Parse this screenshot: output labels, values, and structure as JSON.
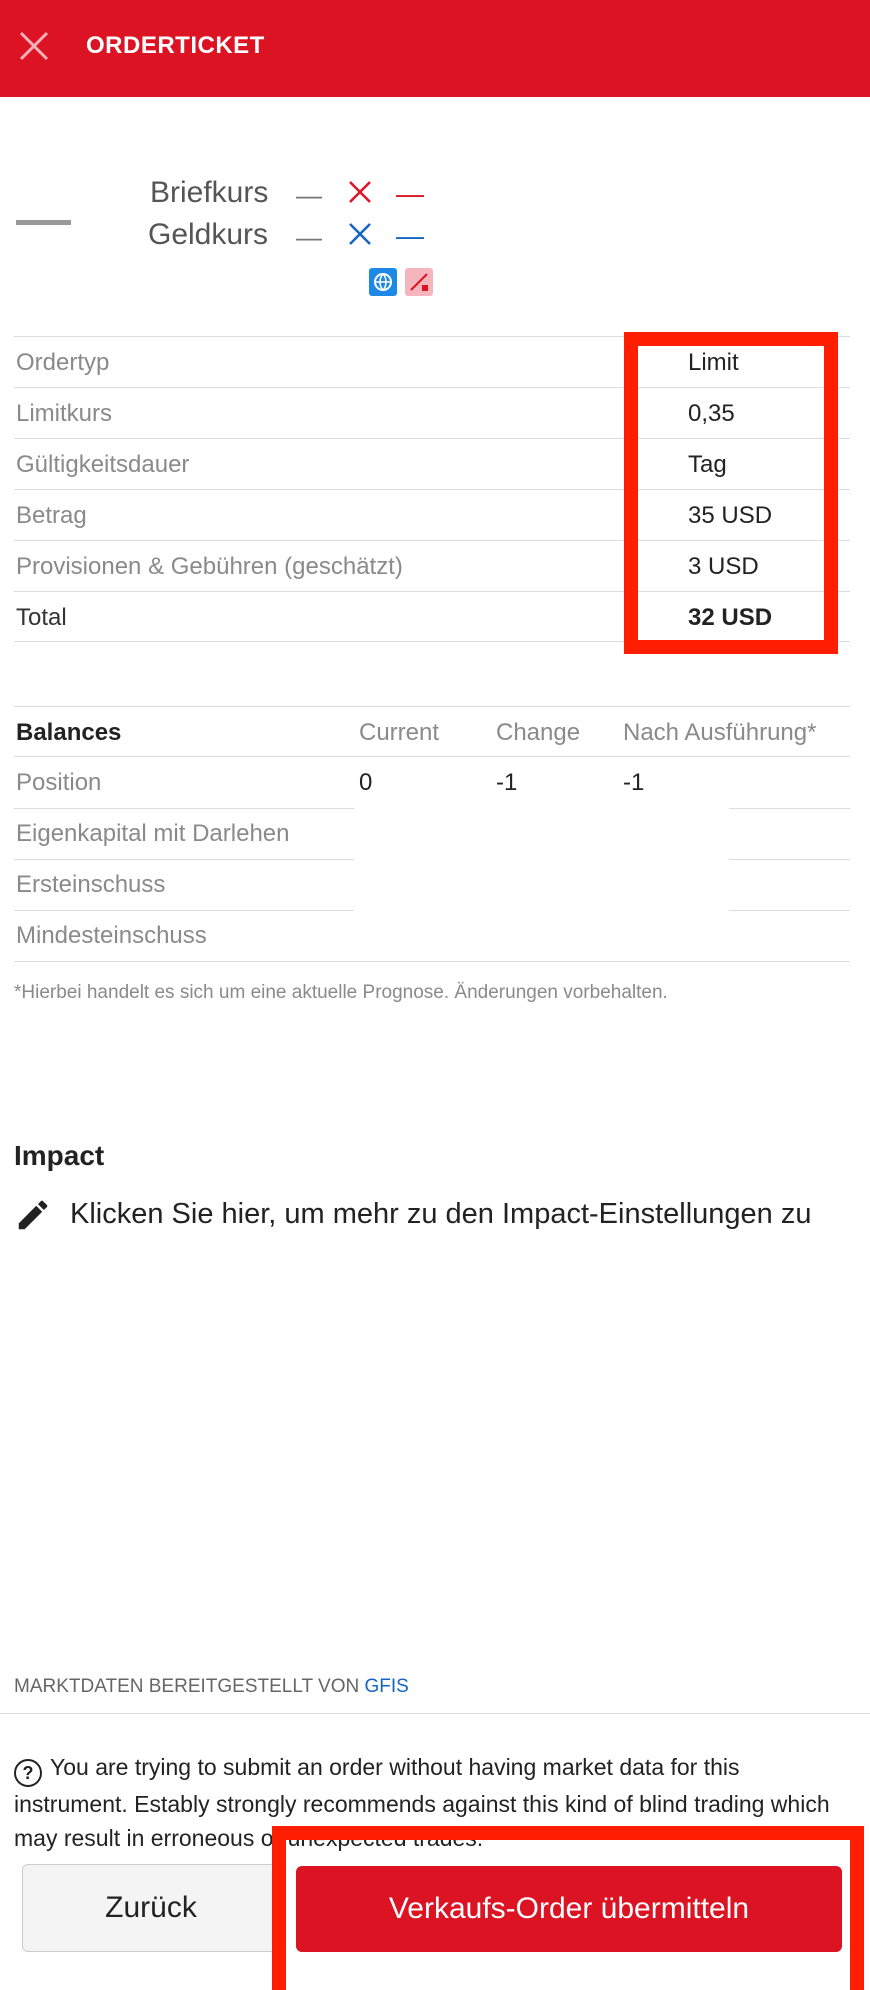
{
  "header": {
    "title": "ORDERTICKET",
    "close_icon": "close-icon"
  },
  "quote": {
    "last_value": "—",
    "ask": {
      "label": "Briefkurs",
      "value": "—",
      "change_icon": "x-icon",
      "change": "—",
      "color": "#dc1323"
    },
    "bid": {
      "label": "Geldkurs",
      "value": "—",
      "change_icon": "x-icon",
      "change": "—",
      "color": "#1565c0"
    },
    "badges": [
      "globe-icon",
      "slash-icon"
    ]
  },
  "order": [
    {
      "label": "Ordertyp",
      "value": "Limit"
    },
    {
      "label": "Limitkurs",
      "value": "0,35"
    },
    {
      "label": "Gültigkeitsdauer",
      "value": "Tag"
    },
    {
      "label": "Betrag",
      "value": "35 USD"
    },
    {
      "label": "Provisionen & Gebühren (geschätzt)",
      "value": "3 USD"
    },
    {
      "label": "Total",
      "value": "32 USD"
    }
  ],
  "balances": {
    "headers": {
      "title": "Balances",
      "current": "Current",
      "change": "Change",
      "after": "Nach Ausführung*"
    },
    "rows": [
      {
        "label": "Position",
        "current": "0",
        "change": "-1",
        "after": "-1"
      },
      {
        "label": "Eigenkapital mit Darlehen",
        "current": "",
        "change": "",
        "after": ""
      },
      {
        "label": "Ersteinschuss",
        "current": "",
        "change": "",
        "after": ""
      },
      {
        "label": "Mindesteinschuss",
        "current": "",
        "change": "",
        "after": ""
      }
    ],
    "note": "*Hierbei handelt es sich um eine aktuelle Prognose. Änderungen vorbehalten."
  },
  "impact": {
    "title": "Impact",
    "link_text": "Klicken Sie hier, um mehr zu den Impact-Einstellungen zu"
  },
  "market_data": {
    "prefix": "MARKTDATEN BEREITGESTELLT VON",
    "provider": "GFIS"
  },
  "warning": "You are trying to submit an order without having market data for this instrument. Estably strongly recommends against this kind of blind trading which may result in erroneous or unexpected trades.",
  "buttons": {
    "back": "Zurück",
    "submit": "Verkaufs-Order übermitteln"
  },
  "colors": {
    "brand": "#dc1323",
    "highlight": "#ff1e00",
    "link": "#1565c0"
  }
}
